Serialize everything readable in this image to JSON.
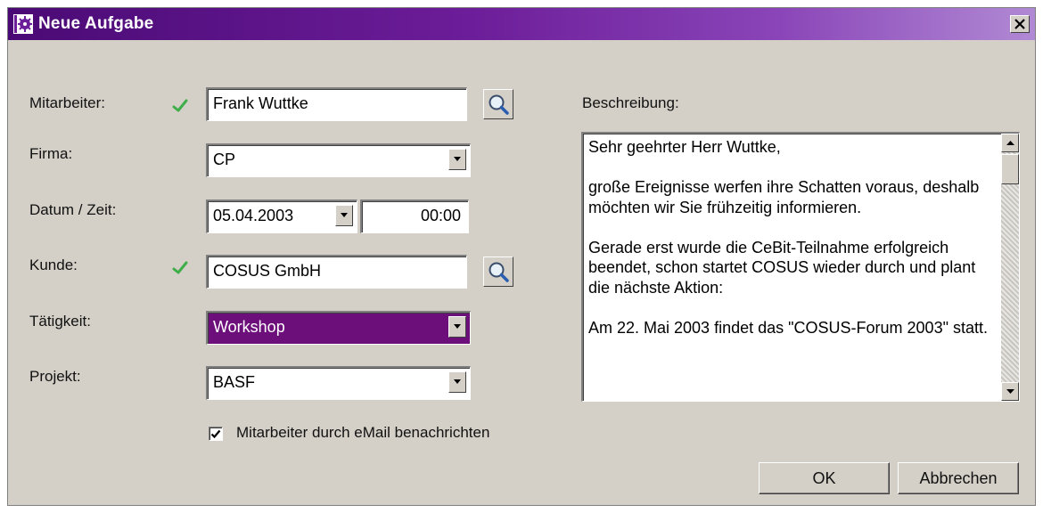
{
  "window": {
    "title": "Neue Aufgabe",
    "accent_color": "#6c1d99",
    "icons": {
      "app": "task-icon",
      "close": "close-icon"
    }
  },
  "form": {
    "mitarbeiter": {
      "label": "Mitarbeiter:",
      "value": "Frank Wuttke",
      "icon": "checkmark-icon",
      "lookup_icon": "search-icon"
    },
    "firma": {
      "label": "Firma:",
      "value": "CP"
    },
    "datum_zeit": {
      "label": "Datum / Zeit:",
      "date": "05.04.2003",
      "time": "00:00"
    },
    "kunde": {
      "label": "Kunde:",
      "value": "COSUS GmbH",
      "icon": "checkmark-icon",
      "lookup_icon": "search-icon"
    },
    "taetigkeit": {
      "label": "Tätigkeit:",
      "value": "Workshop",
      "highlight_color": "#6c0f7a"
    },
    "projekt": {
      "label": "Projekt:",
      "value": "BASF"
    },
    "notify": {
      "label": "Mitarbeiter durch eMail benachrichten",
      "checked": true
    }
  },
  "beschreibung": {
    "label": "Beschreibung:",
    "text": "Sehr geehrter Herr Wuttke,\n\ngroße Ereignisse werfen ihre Schatten voraus, deshalb möchten wir Sie frühzeitig informieren.\n\nGerade erst wurde die CeBit-Teilnahme erfolgreich beendet, schon startet COSUS wieder durch und plant die nächste Aktion:\n\nAm 22. Mai 2003 findet das \"COSUS-Forum 2003\" statt."
  },
  "buttons": {
    "ok": "OK",
    "cancel": "Abbrechen"
  }
}
